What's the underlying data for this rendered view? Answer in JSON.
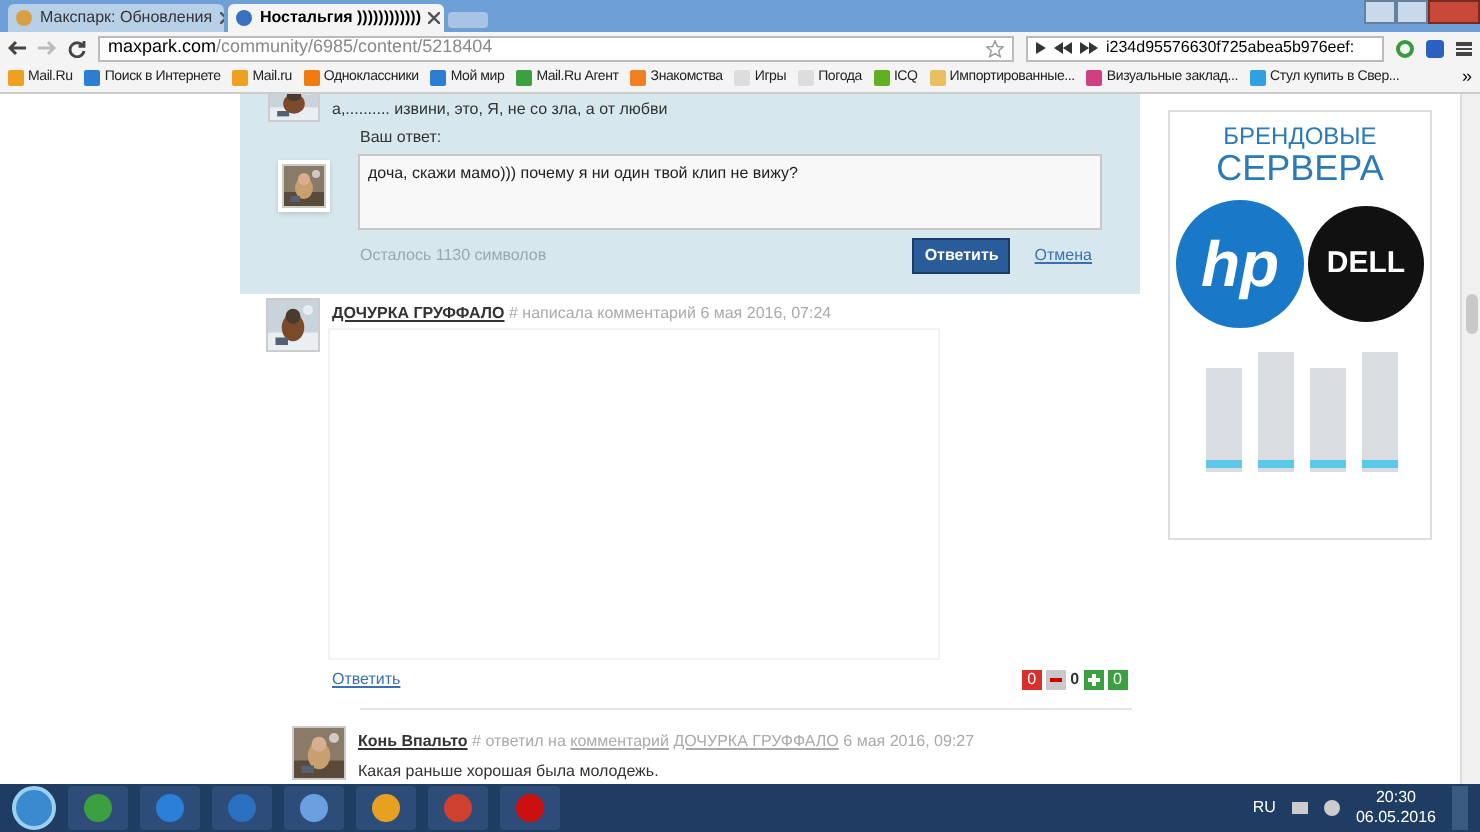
{
  "browser": {
    "tabs": [
      {
        "title": "Макспарк: Обновления",
        "selected": false
      },
      {
        "title": "Ностальгия ))))))))))))",
        "selected": true
      }
    ],
    "address": {
      "host": "maxpark.com",
      "path": "/community/6985/content/5218404"
    },
    "player": {
      "track": "i234d95576630f725abea5b976eef:"
    },
    "bookmarks": [
      {
        "label": "Mail.Ru",
        "color": "#f0a020"
      },
      {
        "label": "Поиск в Интернете",
        "color": "#2a7fd4"
      },
      {
        "label": "Mail.ru",
        "color": "#f0a020"
      },
      {
        "label": "Одноклассники",
        "color": "#f07a10"
      },
      {
        "label": "Мой мир",
        "color": "#2a7fd4"
      },
      {
        "label": "Mail.Ru Агент",
        "color": "#3aa040"
      },
      {
        "label": "Знакомства",
        "color": "#f08020"
      },
      {
        "label": "Игры",
        "color": "#dddddd"
      },
      {
        "label": "Погода",
        "color": "#dddddd"
      },
      {
        "label": "ICQ",
        "color": "#60b020"
      },
      {
        "label": "Импортированные...",
        "color": "#e8c060"
      },
      {
        "label": "Визуальные заклад...",
        "color": "#d04080"
      },
      {
        "label": "Стул купить в Свер...",
        "color": "#30a0e0"
      }
    ],
    "bookmarks_more": "»"
  },
  "reply_form": {
    "quoted_text": "а,.......... извини, это, Я, не со зла, а от любви",
    "label": "Ваш ответ:",
    "value": "доча, скажи мамо))) почему я ни один твой клип не вижу?",
    "remaining": "Осталось 1130 символов",
    "submit": "Ответить",
    "cancel": "Отмена"
  },
  "comments": [
    {
      "author": "ДОЧУРКА ГРУФФАЛО",
      "hash": "#",
      "action": "написала комментарий",
      "date": "6 мая 2016, 07:24",
      "reply": "Ответить",
      "votes": {
        "minus": "0",
        "score": "0",
        "plus": "0"
      }
    },
    {
      "author": "Конь Впальто",
      "hash": "#",
      "action": "ответил на",
      "reply_to": {
        "link": "комментарий",
        "author": "ДОЧУРКА ГРУФФАЛО"
      },
      "date": "6 мая 2016, 09:27",
      "text": "Какая раньше хорошая была молодежь."
    }
  ],
  "ad": {
    "line1": "БРЕНДОВЫЕ",
    "line2": "СЕРВЕРА",
    "logo1": "hp",
    "logo2": "DELL"
  },
  "taskbar": {
    "language": "RU",
    "time": "20:30",
    "date": "06.05.2016"
  }
}
